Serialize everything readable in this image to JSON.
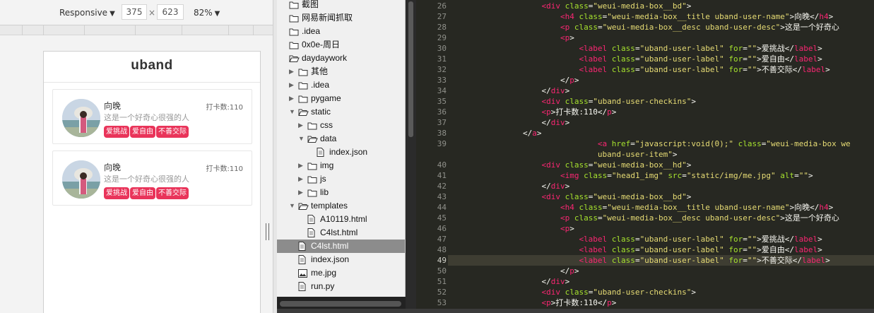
{
  "device_toolbar": {
    "mode": "Responsive",
    "width": "375",
    "times": "×",
    "height": "623",
    "zoom": "82%"
  },
  "app": {
    "logo": "uband"
  },
  "users": [
    {
      "name": "向晚",
      "desc": "这是一个好奇心很强的人",
      "labels": [
        "爱挑战",
        "爱自由",
        "不善交际"
      ],
      "checkins": "打卡数:110"
    },
    {
      "name": "向晚",
      "desc": "这是一个好奇心很强的人",
      "labels": [
        "爱挑战",
        "爱自由",
        "不善交际"
      ],
      "checkins": "打卡数:110"
    }
  ],
  "file_tree": [
    {
      "label": "截图",
      "type": "folder",
      "depth": 0,
      "arrow": ""
    },
    {
      "label": "网易新闻抓取",
      "type": "folder",
      "depth": 0,
      "arrow": ""
    },
    {
      "label": ".idea",
      "type": "folder",
      "depth": 0,
      "arrow": ""
    },
    {
      "label": "0x0e-周日",
      "type": "folder",
      "depth": 0,
      "arrow": ""
    },
    {
      "label": "daydaywork",
      "type": "folder-open",
      "depth": 0,
      "arrow": ""
    },
    {
      "label": "其他",
      "type": "folder",
      "depth": 1,
      "arrow": "right"
    },
    {
      "label": ".idea",
      "type": "folder",
      "depth": 1,
      "arrow": "right"
    },
    {
      "label": "pygame",
      "type": "folder",
      "depth": 1,
      "arrow": "right"
    },
    {
      "label": "static",
      "type": "folder-open",
      "depth": 1,
      "arrow": "down"
    },
    {
      "label": "css",
      "type": "folder",
      "depth": 2,
      "arrow": "right"
    },
    {
      "label": "data",
      "type": "folder-open",
      "depth": 2,
      "arrow": "down"
    },
    {
      "label": "index.json",
      "type": "file",
      "depth": 3,
      "arrow": ""
    },
    {
      "label": "img",
      "type": "folder",
      "depth": 2,
      "arrow": "right"
    },
    {
      "label": "js",
      "type": "folder",
      "depth": 2,
      "arrow": "right"
    },
    {
      "label": "lib",
      "type": "folder",
      "depth": 2,
      "arrow": "right"
    },
    {
      "label": "templates",
      "type": "folder-open",
      "depth": 1,
      "arrow": "down"
    },
    {
      "label": "A10119.html",
      "type": "file",
      "depth": 2,
      "arrow": ""
    },
    {
      "label": "C4lst.html",
      "type": "file",
      "depth": 2,
      "arrow": ""
    },
    {
      "label": "C4lst.html",
      "type": "file",
      "depth": 1,
      "arrow": "",
      "selected": true
    },
    {
      "label": "index.json",
      "type": "file",
      "depth": 1,
      "arrow": ""
    },
    {
      "label": "me.jpg",
      "type": "image",
      "depth": 1,
      "arrow": ""
    },
    {
      "label": "run.py",
      "type": "file",
      "depth": 1,
      "arrow": ""
    }
  ],
  "editor": {
    "current_line": 49,
    "lines": [
      {
        "n": 26,
        "tokens": [
          [
            "p",
            "                    "
          ],
          [
            "t",
            "<div"
          ],
          [
            "p",
            " "
          ],
          [
            "a",
            "class"
          ],
          [
            "p",
            "="
          ],
          [
            "s",
            "\"weui-media-box__bd\""
          ],
          [
            "p",
            ">"
          ]
        ]
      },
      {
        "n": 27,
        "tokens": [
          [
            "p",
            "                        "
          ],
          [
            "t",
            "<h4"
          ],
          [
            "p",
            " "
          ],
          [
            "a",
            "class"
          ],
          [
            "p",
            "="
          ],
          [
            "s",
            "\"weui-media-box__title uband-user-name\""
          ],
          [
            "p",
            ">向晚</"
          ],
          [
            "t",
            "h4"
          ],
          [
            "p",
            ">"
          ]
        ]
      },
      {
        "n": 28,
        "tokens": [
          [
            "p",
            "                        "
          ],
          [
            "t",
            "<p"
          ],
          [
            "p",
            " "
          ],
          [
            "a",
            "class"
          ],
          [
            "p",
            "="
          ],
          [
            "s",
            "\"weui-media-box__desc uband-user-desc\""
          ],
          [
            "p",
            ">这是一个好奇心"
          ]
        ]
      },
      {
        "n": 29,
        "tokens": [
          [
            "p",
            "                        "
          ],
          [
            "t",
            "<p"
          ],
          [
            "p",
            ">"
          ]
        ]
      },
      {
        "n": 30,
        "tokens": [
          [
            "p",
            "                            "
          ],
          [
            "t",
            "<label"
          ],
          [
            "p",
            " "
          ],
          [
            "a",
            "class"
          ],
          [
            "p",
            "="
          ],
          [
            "s",
            "\"uband-user-label\""
          ],
          [
            "p",
            " "
          ],
          [
            "a",
            "for"
          ],
          [
            "p",
            "="
          ],
          [
            "s",
            "\"\""
          ],
          [
            "p",
            ">爱挑战</"
          ],
          [
            "t",
            "label"
          ],
          [
            "p",
            ">"
          ]
        ]
      },
      {
        "n": 31,
        "tokens": [
          [
            "p",
            "                            "
          ],
          [
            "t",
            "<label"
          ],
          [
            "p",
            " "
          ],
          [
            "a",
            "class"
          ],
          [
            "p",
            "="
          ],
          [
            "s",
            "\"uband-user-label\""
          ],
          [
            "p",
            " "
          ],
          [
            "a",
            "for"
          ],
          [
            "p",
            "="
          ],
          [
            "s",
            "\"\""
          ],
          [
            "p",
            ">爱自由</"
          ],
          [
            "t",
            "label"
          ],
          [
            "p",
            ">"
          ]
        ]
      },
      {
        "n": 32,
        "tokens": [
          [
            "p",
            "                            "
          ],
          [
            "t",
            "<label"
          ],
          [
            "p",
            " "
          ],
          [
            "a",
            "class"
          ],
          [
            "p",
            "="
          ],
          [
            "s",
            "\"uband-user-label\""
          ],
          [
            "p",
            " "
          ],
          [
            "a",
            "for"
          ],
          [
            "p",
            "="
          ],
          [
            "s",
            "\"\""
          ],
          [
            "p",
            ">不善交际</"
          ],
          [
            "t",
            "label"
          ],
          [
            "p",
            ">"
          ]
        ]
      },
      {
        "n": 33,
        "tokens": [
          [
            "p",
            "                        </"
          ],
          [
            "t",
            "p"
          ],
          [
            "p",
            ">"
          ]
        ]
      },
      {
        "n": 34,
        "tokens": [
          [
            "p",
            "                    </"
          ],
          [
            "t",
            "div"
          ],
          [
            "p",
            ">"
          ]
        ]
      },
      {
        "n": 35,
        "tokens": [
          [
            "p",
            "                    "
          ],
          [
            "t",
            "<div"
          ],
          [
            "p",
            " "
          ],
          [
            "a",
            "class"
          ],
          [
            "p",
            "="
          ],
          [
            "s",
            "\"uband-user-checkins\""
          ],
          [
            "p",
            ">"
          ]
        ]
      },
      {
        "n": 36,
        "tokens": [
          [
            "p",
            "                    "
          ],
          [
            "t",
            "<p"
          ],
          [
            "p",
            ">打卡数:110</"
          ],
          [
            "t",
            "p"
          ],
          [
            "p",
            ">"
          ]
        ]
      },
      {
        "n": 37,
        "tokens": [
          [
            "p",
            "                    </"
          ],
          [
            "t",
            "div"
          ],
          [
            "p",
            ">"
          ]
        ]
      },
      {
        "n": 38,
        "tokens": [
          [
            "p",
            "                </"
          ],
          [
            "t",
            "a"
          ],
          [
            "p",
            ">"
          ]
        ]
      },
      {
        "n": 39,
        "tokens": [
          [
            "p",
            "                                "
          ],
          [
            "t",
            "<a"
          ],
          [
            "p",
            " "
          ],
          [
            "a",
            "href"
          ],
          [
            "p",
            "="
          ],
          [
            "s",
            "\"javascript:void(0);\""
          ],
          [
            "p",
            " "
          ],
          [
            "a",
            "class"
          ],
          [
            "p",
            "="
          ],
          [
            "s",
            "\"weui-media-box we"
          ]
        ]
      },
      {
        "n": "",
        "tokens": [
          [
            "s",
            "                                uband-user-item\""
          ],
          [
            "p",
            ">"
          ]
        ]
      },
      {
        "n": 40,
        "tokens": [
          [
            "p",
            "                    "
          ],
          [
            "t",
            "<div"
          ],
          [
            "p",
            " "
          ],
          [
            "a",
            "class"
          ],
          [
            "p",
            "="
          ],
          [
            "s",
            "\"weui-media-box__hd\""
          ],
          [
            "p",
            ">"
          ]
        ]
      },
      {
        "n": 41,
        "tokens": [
          [
            "p",
            "                        "
          ],
          [
            "t",
            "<img"
          ],
          [
            "p",
            " "
          ],
          [
            "a",
            "class"
          ],
          [
            "p",
            "="
          ],
          [
            "s",
            "\"head1_img\""
          ],
          [
            "p",
            " "
          ],
          [
            "a",
            "src"
          ],
          [
            "p",
            "="
          ],
          [
            "s",
            "\"static/img/me.jpg\""
          ],
          [
            "p",
            " "
          ],
          [
            "a",
            "alt"
          ],
          [
            "p",
            "="
          ],
          [
            "s",
            "\"\""
          ],
          [
            "p",
            ">"
          ]
        ]
      },
      {
        "n": 42,
        "tokens": [
          [
            "p",
            "                    </"
          ],
          [
            "t",
            "div"
          ],
          [
            "p",
            ">"
          ]
        ]
      },
      {
        "n": 43,
        "tokens": [
          [
            "p",
            "                    "
          ],
          [
            "t",
            "<div"
          ],
          [
            "p",
            " "
          ],
          [
            "a",
            "class"
          ],
          [
            "p",
            "="
          ],
          [
            "s",
            "\"weui-media-box__bd\""
          ],
          [
            "p",
            ">"
          ]
        ]
      },
      {
        "n": 44,
        "tokens": [
          [
            "p",
            "                        "
          ],
          [
            "t",
            "<h4"
          ],
          [
            "p",
            " "
          ],
          [
            "a",
            "class"
          ],
          [
            "p",
            "="
          ],
          [
            "s",
            "\"weui-media-box__title uband-user-name\""
          ],
          [
            "p",
            ">向晚</"
          ],
          [
            "t",
            "h4"
          ],
          [
            "p",
            ">"
          ]
        ]
      },
      {
        "n": 45,
        "tokens": [
          [
            "p",
            "                        "
          ],
          [
            "t",
            "<p"
          ],
          [
            "p",
            " "
          ],
          [
            "a",
            "class"
          ],
          [
            "p",
            "="
          ],
          [
            "s",
            "\"weui-media-box__desc uband-user-desc\""
          ],
          [
            "p",
            ">这是一个好奇心"
          ]
        ]
      },
      {
        "n": 46,
        "tokens": [
          [
            "p",
            "                        "
          ],
          [
            "t",
            "<p"
          ],
          [
            "p",
            ">"
          ]
        ]
      },
      {
        "n": 47,
        "tokens": [
          [
            "p",
            "                            "
          ],
          [
            "t",
            "<label"
          ],
          [
            "p",
            " "
          ],
          [
            "a",
            "class"
          ],
          [
            "p",
            "="
          ],
          [
            "s",
            "\"uband-user-label\""
          ],
          [
            "p",
            " "
          ],
          [
            "a",
            "for"
          ],
          [
            "p",
            "="
          ],
          [
            "s",
            "\"\""
          ],
          [
            "p",
            ">爱挑战</"
          ],
          [
            "t",
            "label"
          ],
          [
            "p",
            ">"
          ]
        ]
      },
      {
        "n": 48,
        "tokens": [
          [
            "p",
            "                            "
          ],
          [
            "t",
            "<label"
          ],
          [
            "p",
            " "
          ],
          [
            "a",
            "class"
          ],
          [
            "p",
            "="
          ],
          [
            "s",
            "\"uband-user-label\""
          ],
          [
            "p",
            " "
          ],
          [
            "a",
            "for"
          ],
          [
            "p",
            "="
          ],
          [
            "s",
            "\"\""
          ],
          [
            "p",
            ">爱自由</"
          ],
          [
            "t",
            "label"
          ],
          [
            "p",
            ">"
          ]
        ]
      },
      {
        "n": 49,
        "tokens": [
          [
            "p",
            "                            "
          ],
          [
            "t",
            "<label"
          ],
          [
            "p",
            " "
          ],
          [
            "a",
            "class"
          ],
          [
            "p",
            "="
          ],
          [
            "s",
            "\"uband-user-label\""
          ],
          [
            "p",
            " "
          ],
          [
            "a",
            "for"
          ],
          [
            "p",
            "="
          ],
          [
            "s",
            "\"\""
          ],
          [
            "p",
            ">不善交际</"
          ],
          [
            "t",
            "label"
          ],
          [
            "p",
            ">"
          ]
        ]
      },
      {
        "n": 50,
        "tokens": [
          [
            "p",
            "                        </"
          ],
          [
            "t",
            "p"
          ],
          [
            "p",
            ">"
          ]
        ]
      },
      {
        "n": 51,
        "tokens": [
          [
            "p",
            "                    </"
          ],
          [
            "t",
            "div"
          ],
          [
            "p",
            ">"
          ]
        ]
      },
      {
        "n": 52,
        "tokens": [
          [
            "p",
            "                    "
          ],
          [
            "t",
            "<div"
          ],
          [
            "p",
            " "
          ],
          [
            "a",
            "class"
          ],
          [
            "p",
            "="
          ],
          [
            "s",
            "\"uband-user-checkins\""
          ],
          [
            "p",
            ">"
          ]
        ]
      },
      {
        "n": 53,
        "tokens": [
          [
            "p",
            "                    "
          ],
          [
            "t",
            "<p"
          ],
          [
            "p",
            ">打卡数:110</"
          ],
          [
            "t",
            "p"
          ],
          [
            "p",
            ">"
          ]
        ]
      }
    ]
  },
  "colors": {
    "tag": "#e9345a",
    "editor_bg": "#272822",
    "tag_token": "#f92672",
    "attr_token": "#a6e22e",
    "string_token": "#e6db74"
  }
}
